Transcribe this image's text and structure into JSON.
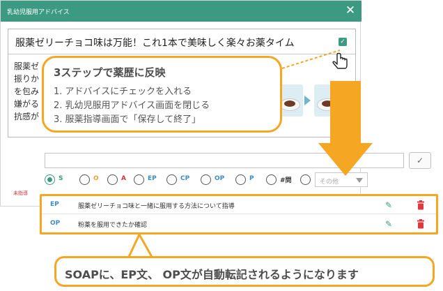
{
  "dialog": {
    "title": "乳幼児服用アドバイス",
    "close_label": "✕",
    "advice_title": "服薬ゼリーチョコ味は万能！これ1本で美味しく楽々お薬タイム",
    "advice_body_lines": [
      "服薬ゼ",
      "振りか",
      "を包み",
      "嫌がる",
      "抗感が"
    ],
    "unguided_label": "未指導"
  },
  "callout_steps": {
    "heading": "3ステップで薬歴に反映",
    "steps": [
      "1. アドバイスにチェックを入れる",
      "2. 乳幼児服用アドバイス画面を閉じる",
      "3. 服薬指導画面で「保存して終了」"
    ]
  },
  "soap": {
    "input_value": "",
    "ok_button": "✓",
    "radios": [
      {
        "label": "S",
        "selected": true,
        "color": "#3d9a82"
      },
      {
        "label": "O",
        "selected": false,
        "color": "#e0a23a"
      },
      {
        "label": "A",
        "selected": false,
        "color": "#d9333b"
      },
      {
        "label": "EP",
        "selected": false,
        "color": "#3d8dbf"
      },
      {
        "label": "CP",
        "selected": false,
        "color": "#3d8dbf"
      },
      {
        "label": "OP",
        "selected": false,
        "color": "#3d8dbf"
      },
      {
        "label": "P",
        "selected": false,
        "color": "#3d8dbf"
      },
      {
        "label": "#問",
        "selected": false,
        "color": "#333333"
      },
      {
        "label": "",
        "selected": false,
        "color": "#333333"
      }
    ],
    "other_select": "その他",
    "rows": [
      {
        "code": "EP",
        "text": "服薬ゼリーチョコ味と一緒に服用する方法について指導"
      },
      {
        "code": "OP",
        "text": "粉薬を服用できたか確認"
      }
    ]
  },
  "bottom_callout": "SOAPに、EP文、 OP文が自動転記されるようになります",
  "colors": {
    "accent": "#3d9a82",
    "highlight": "#f5a623",
    "delete": "#e0383f"
  }
}
